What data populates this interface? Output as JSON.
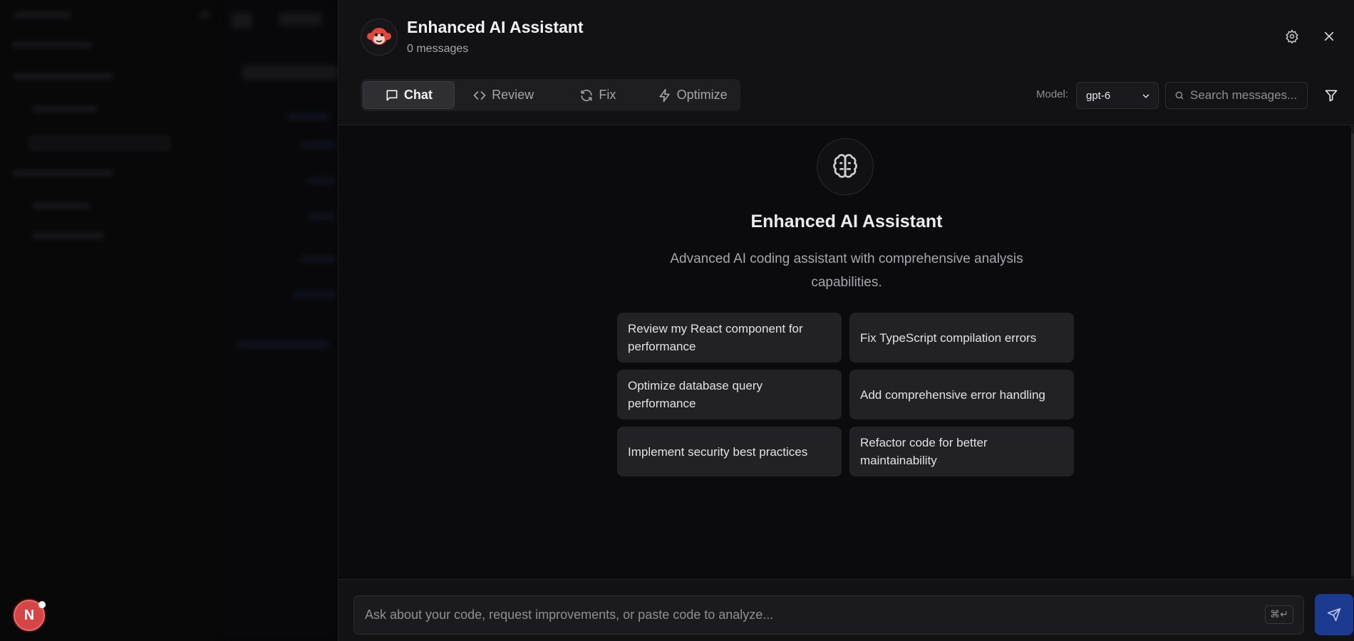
{
  "drawer": {
    "title": "Enhanced AI Assistant",
    "message_count": "0 messages",
    "logo_icon": "monkey-logo-icon",
    "settings_icon": "gear-icon",
    "close_icon": "close-icon"
  },
  "tabs": [
    {
      "label": "Chat",
      "icon": "message-square-icon",
      "active": true
    },
    {
      "label": "Review",
      "icon": "code-icon",
      "active": false
    },
    {
      "label": "Fix",
      "icon": "refresh-icon",
      "active": false
    },
    {
      "label": "Optimize",
      "icon": "zap-icon",
      "active": false
    }
  ],
  "toolbar": {
    "model_label": "Model:",
    "model_value": "gpt-6",
    "search_placeholder": "Search messages...",
    "filter_icon": "filter-icon"
  },
  "hero": {
    "icon": "brain-icon",
    "title": "Enhanced AI Assistant",
    "description": "Advanced AI coding assistant with comprehensive analysis capabilities."
  },
  "suggestions": [
    "Review my React component for performance",
    "Fix TypeScript compilation errors",
    "Optimize database query performance",
    "Add comprehensive error handling",
    "Implement security best practices",
    "Refactor code for better maintainability"
  ],
  "composer": {
    "placeholder": "Ask about your code, request improvements, or paste code to analyze...",
    "shortcut": "⌘↵",
    "send_icon": "send-icon"
  },
  "user_badge": {
    "initial": "N"
  },
  "colors": {
    "accent": "#1c3a8f",
    "badge": "#d64545",
    "panel": "#121214",
    "background": "#0b0b0d"
  }
}
